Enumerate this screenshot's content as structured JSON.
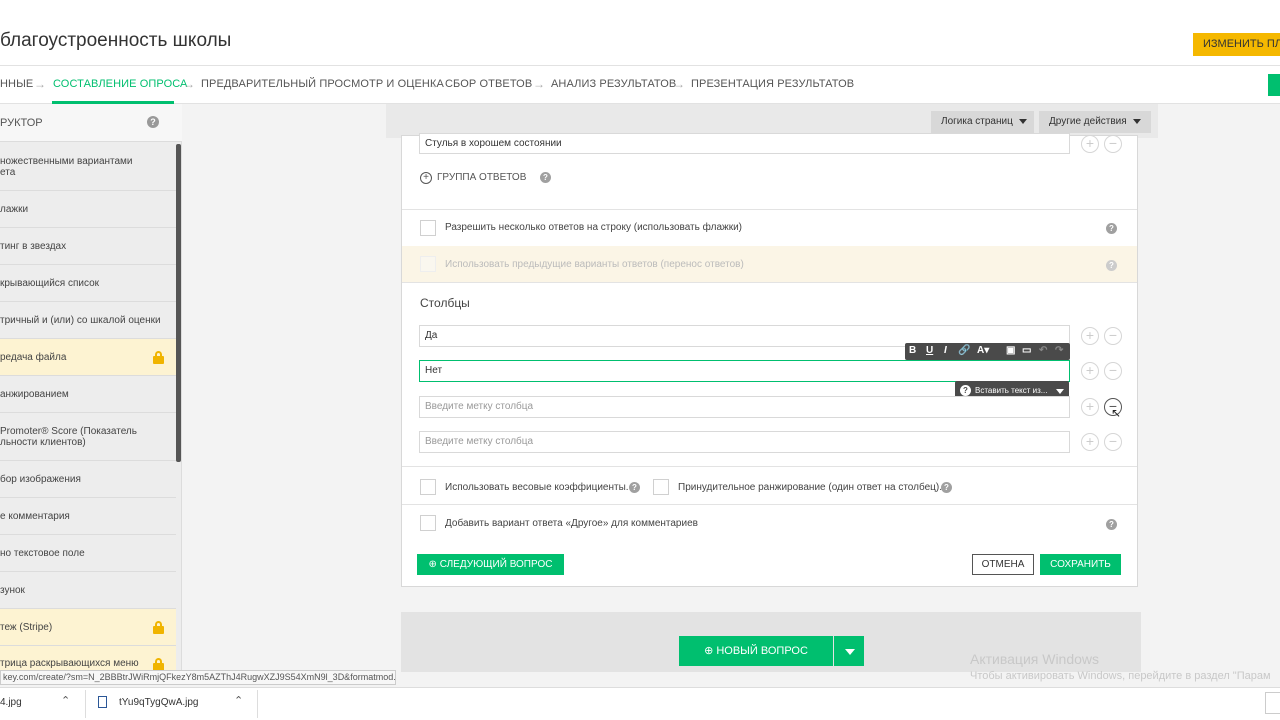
{
  "header": {
    "survey_title": "благоустроенность школы",
    "upgrade_label": "ИЗМЕНИТЬ ПЛА"
  },
  "steps": [
    {
      "label": "ННЫЕ"
    },
    {
      "label": "СОСТАВЛЕНИЕ ОПРОСА"
    },
    {
      "label": "ПРЕДВАРИТЕЛЬНЫЙ ПРОСМОТР И ОЦЕНКА"
    },
    {
      "label": "СБОР ОТВЕТОВ"
    },
    {
      "label": "АНАЛИЗ РЕЗУЛЬТАТОВ"
    },
    {
      "label": "ПРЕЗЕНТАЦИЯ РЕЗУЛЬТАТОВ"
    }
  ],
  "sidebar": {
    "title": "РУКТОР",
    "items": [
      {
        "label": "ножественными вариантами\nета"
      },
      {
        "label": "лажки"
      },
      {
        "label": "тинг в звездах"
      },
      {
        "label": "крывающийся список"
      },
      {
        "label": "тричный и (или) со шкалой оценки"
      },
      {
        "label": "редача файла"
      },
      {
        "label": "анжированием"
      },
      {
        "label": "Promoter® Score (Показатель\nльности клиентов)"
      },
      {
        "label": "бор изображения"
      },
      {
        "label": "е комментария"
      },
      {
        "label": "но текстовое поле"
      },
      {
        "label": "зунок"
      },
      {
        "label": "теж (Stripe)"
      },
      {
        "label": "трица раскрывающихся меню"
      }
    ]
  },
  "toolbar": {
    "page_logic": "Логика страниц",
    "other_actions": "Другие действия"
  },
  "editor": {
    "row_value": "Стулья в хорошем состоянии",
    "answer_group": "ГРУППА ОТВЕТОВ",
    "allow_multiple": "Разрешить несколько ответов на строку (использовать флажки)",
    "carry_forward": "Использовать предыдущие варианты ответов (перенос ответов)",
    "columns_heading": "Столбцы",
    "columns": [
      "Да",
      "Нет"
    ],
    "column_placeholder": "Введите метку столбца",
    "insert_text": "Вставить текст из...",
    "weights": "Использовать весовые коэффициенты.",
    "forced_ranking": "Принудительное ранжирование (один ответ на столбец).",
    "other_option": "Добавить вариант ответа «Другое» для комментариев",
    "next_question": "СЛЕДУЮЩИЙ ВОПРОС",
    "cancel": "ОТМЕНА",
    "save": "СОХРАНИТЬ"
  },
  "bottom": {
    "new_question": "НОВЫЙ ВОПРОС",
    "windows_title": "Активация Windows",
    "windows_text": "Чтобы активировать Windows, перейдите в раздел \"Парам"
  },
  "status_url": "key.com/create/?sm=N_2BBBtrJWiRmjQFkezY8m5AZThJ4RugwXZJ9S54XmN9l_3D&formatmod...",
  "downloads": [
    {
      "name": "4.jpg"
    },
    {
      "name": "tYu9qTygQwA.jpg"
    }
  ],
  "colors": {
    "accent": "#00bf6f",
    "upgrade": "#f5b800",
    "locked_bg": "#fdf3d2"
  }
}
